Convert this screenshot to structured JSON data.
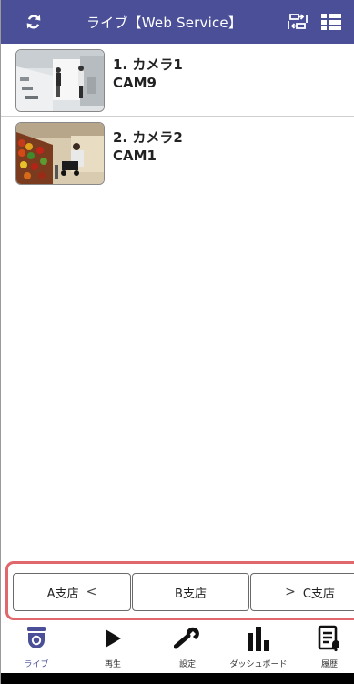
{
  "header": {
    "title": "ライブ【Web Service】",
    "refresh_icon": "refresh-icon",
    "switch_icon": "camera-switch-icon",
    "grid_icon": "grid-layout-icon"
  },
  "cameras": [
    {
      "name": "1. カメラ1",
      "id": "CAM9"
    },
    {
      "name": "2. カメラ2",
      "id": "CAM1"
    }
  ],
  "branches": {
    "prev_label": "A支店",
    "prev_chevron": "<",
    "current_label": "B支店",
    "next_chevron": ">",
    "next_label": "C支店",
    "highlight_color": "#e0676b"
  },
  "nav": {
    "live": "ライブ",
    "playback": "再生",
    "settings": "設定",
    "dashboard": "ダッシュボード",
    "history": "履歴"
  },
  "colors": {
    "header_bg": "#4a4f98",
    "active_nav": "#4a4f98"
  }
}
